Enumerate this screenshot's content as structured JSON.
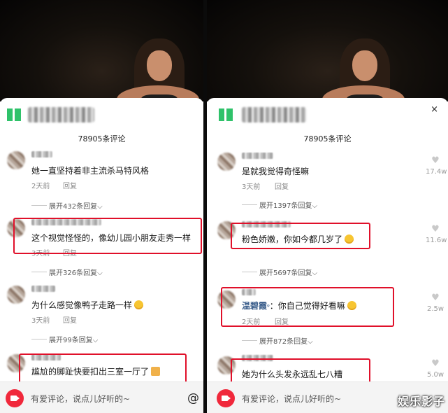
{
  "comment_count": "78905条评论",
  "input_placeholder": "有爱评论，说点儿好听的~",
  "at_symbol": "@",
  "watermark": "娱乐影子",
  "close_symbol": "×",
  "left": {
    "comments": [
      {
        "text": "她一直坚持着非主流杀马特风格",
        "time": "2天前",
        "reply": "回复",
        "expand": "展开432条回复"
      },
      {
        "text": "这个视觉怪怪的，像幼儿园小朋友走秀一样",
        "time": "3天前",
        "reply": "回复",
        "expand": "展开326条回复"
      },
      {
        "text": "为什么感觉像鸭子走路一样",
        "time": "3天前",
        "reply": "回复",
        "expand": "展开99条回复"
      },
      {
        "text": "尴尬的脚趾快要扣出三室一厅了"
      }
    ]
  },
  "right": {
    "comments": [
      {
        "text": "是就我觉得奇怪嘛",
        "time": "3天前",
        "reply": "回复",
        "likes": "17.4w",
        "expand": "展开1397条回复"
      },
      {
        "text": "粉色娇嫩，你如今都几岁了",
        "likes": "11.6w",
        "expand": "展开5697条回复"
      },
      {
        "name": "温碧霞",
        "text": "：你自己觉得好看嘛",
        "time": "2天前",
        "reply": "回复",
        "likes": "2.5w",
        "expand": "展开872条回复"
      },
      {
        "text": "她为什么头发永远乱七八糟",
        "likes": "5.0w"
      }
    ]
  },
  "colors": {
    "highlight": "#e0102a",
    "camera": "#f0283b",
    "username_blue": "#3c5f8c"
  },
  "icons": [
    "heart-icon",
    "camera-icon",
    "close-icon",
    "chevron-down-icon",
    "emoji-icon"
  ]
}
